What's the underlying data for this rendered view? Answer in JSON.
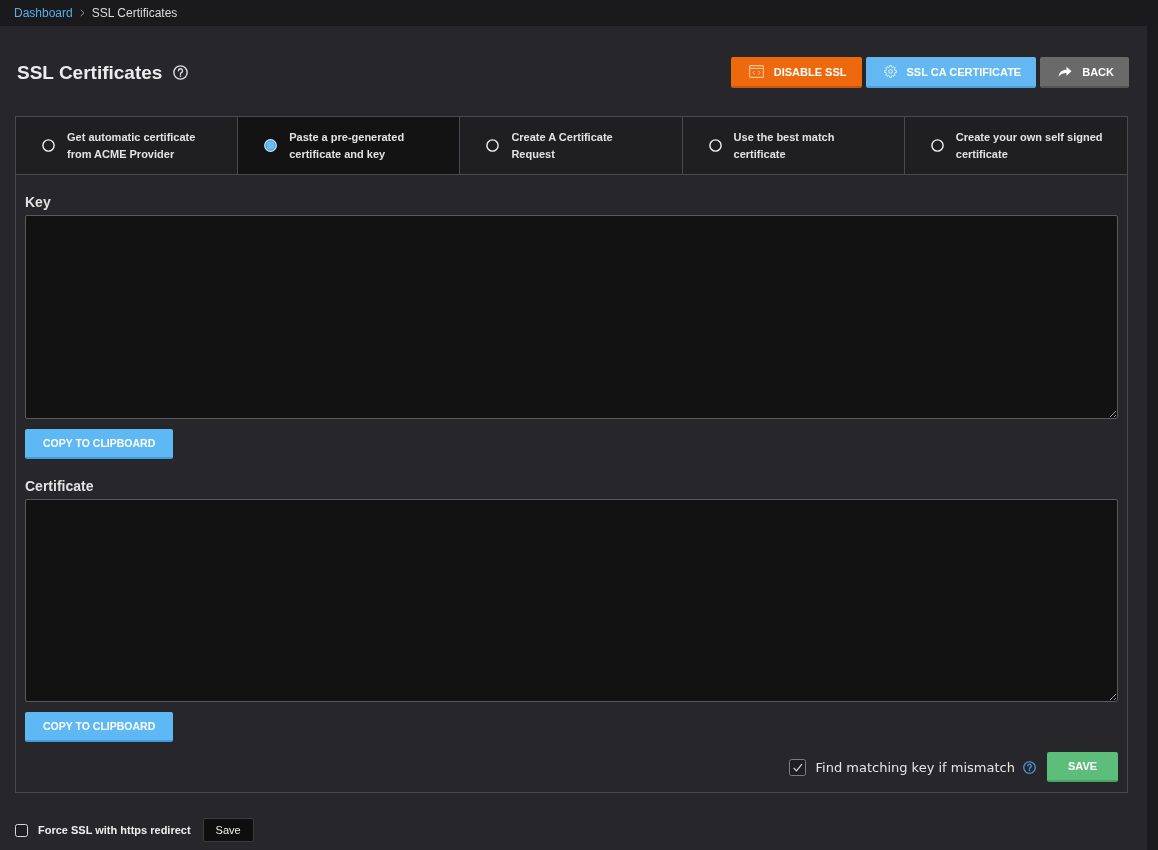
{
  "breadcrumb": [
    {
      "label": "Dashboard",
      "kind": "link"
    },
    {
      "label": "SSL Certificates",
      "kind": "current"
    }
  ],
  "header": {
    "title": "SSL Certificates",
    "actions": [
      {
        "label": "DISABLE SSL",
        "kind": "danger"
      },
      {
        "label": "SSL CA CERTIFICATE",
        "kind": "info"
      },
      {
        "label": "BACK",
        "kind": "back"
      }
    ]
  },
  "tabs": [
    {
      "label": "Get automatic certificate\nfrom ACME Provider",
      "selected": false
    },
    {
      "label": "Paste a pre-generated\ncertificate and key",
      "selected": true
    },
    {
      "label": "Create A Certificate\nRequest",
      "selected": false
    },
    {
      "label": "Use the best match\ncertificate",
      "selected": false
    },
    {
      "label": "Create your own self signed\ncertificate",
      "selected": false
    }
  ],
  "fields": [
    {
      "label": "Key",
      "button": "COPY TO CLIPBOARD"
    },
    {
      "label": "Certificate",
      "button": "COPY TO CLIPBOARD"
    }
  ],
  "footer": {
    "option": {
      "label": "Find matching key if mismatch",
      "checked": true
    },
    "button": "SAVE"
  },
  "force_ssl": {
    "label": "Force SSL with https redirect",
    "checked": false,
    "button": "Save"
  }
}
